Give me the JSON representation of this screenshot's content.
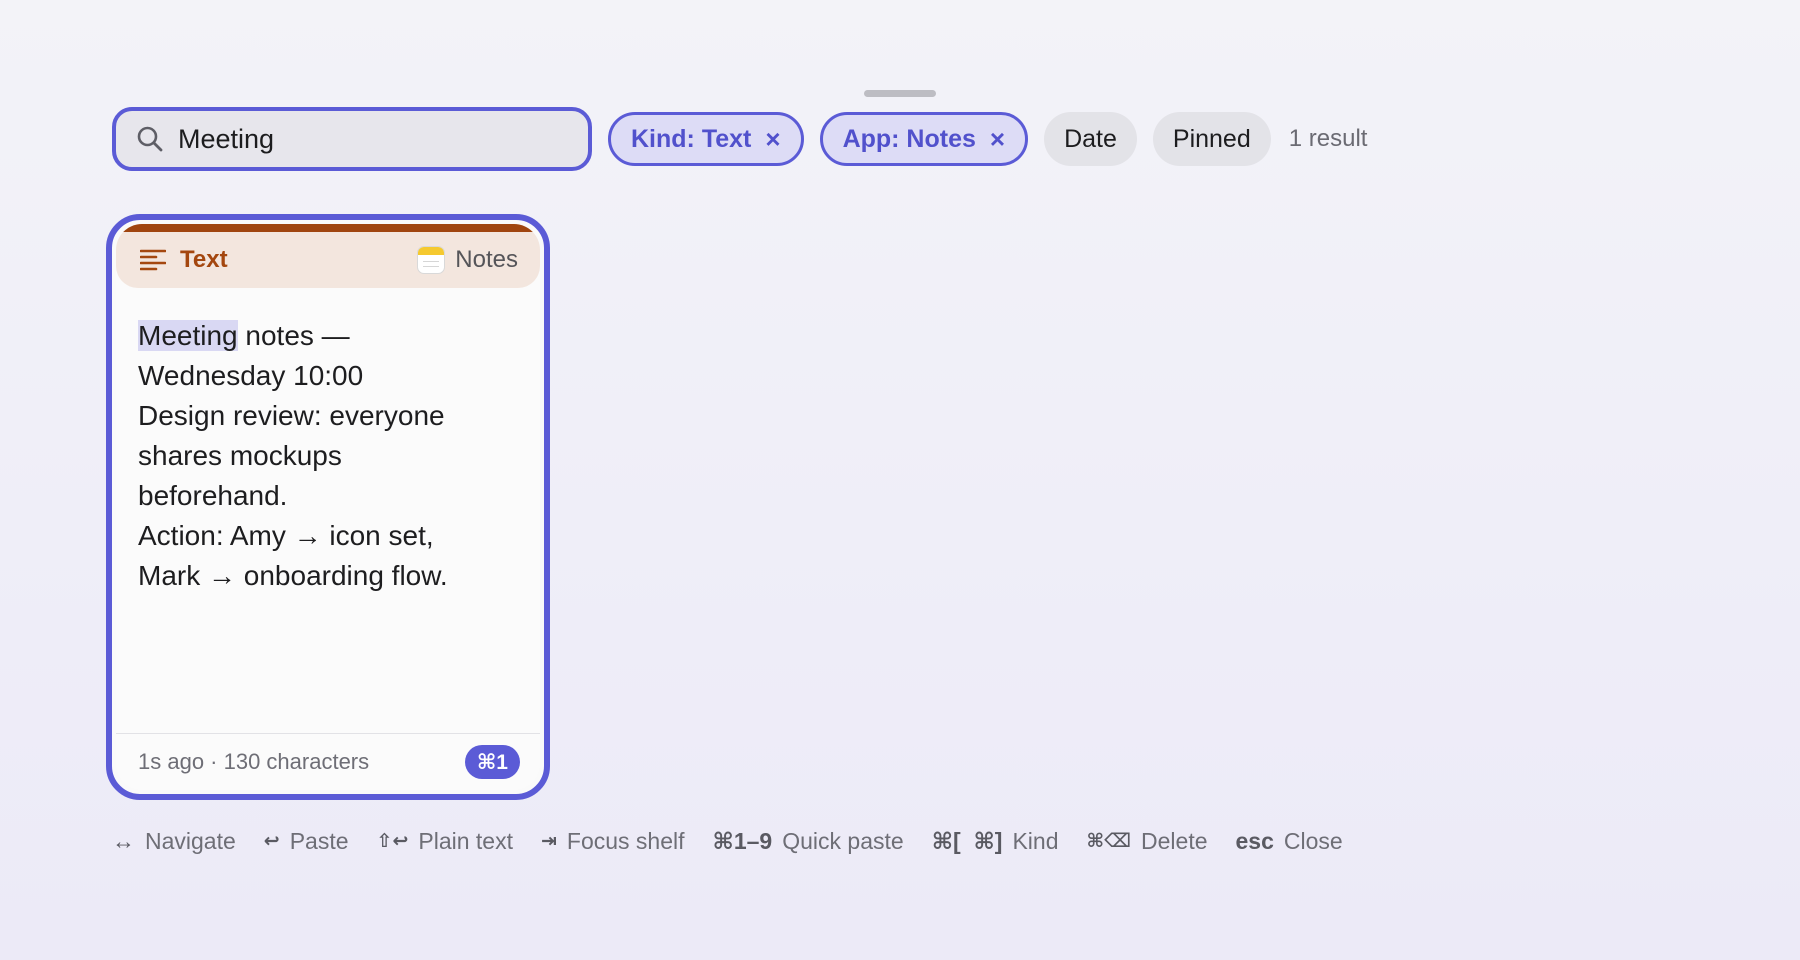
{
  "search": {
    "value": "Meeting",
    "placeholder": ""
  },
  "filters": {
    "active": [
      {
        "label": "Kind: Text",
        "remove": "×"
      },
      {
        "label": "App: Notes",
        "remove": "×"
      }
    ],
    "options": [
      {
        "label": "Date"
      },
      {
        "label": "Pinned"
      }
    ],
    "result_count": "1 result"
  },
  "card": {
    "kind": "Text",
    "app": "Notes",
    "body": {
      "highlight": "Meeting",
      "line1_rest": " notes —",
      "lines": [
        "Wednesday 10:00",
        "Design review: everyone",
        "shares mockups",
        "beforehand.",
        "Action: Amy → icon set,",
        "Mark → onboarding flow."
      ]
    },
    "meta": "1s ago · 130 characters",
    "shortcut": "⌘1"
  },
  "hints": [
    {
      "key": "↔",
      "label": "Navigate"
    },
    {
      "key": "↩",
      "label": "Paste"
    },
    {
      "key": "⇧↩",
      "label": "Plain text"
    },
    {
      "key": "⇥",
      "label": "Focus shelf"
    },
    {
      "key": "⌘1–9",
      "label": "Quick paste"
    },
    {
      "key": "⌘[  ⌘]",
      "label": "Kind"
    },
    {
      "key": "⌘⌫",
      "label": "Delete"
    },
    {
      "key": "esc",
      "label": "Close"
    }
  ],
  "colors": {
    "accent": "#5b5bd6",
    "kind_text": "#a4470f",
    "kind_bar": "#a0450f",
    "header_bg": "#f3e6de",
    "highlight": "#d9d8f3"
  },
  "icons": {
    "search": "search-icon",
    "kind": "text-lines-icon",
    "app": "notes-app-icon",
    "remove": "close-icon"
  }
}
